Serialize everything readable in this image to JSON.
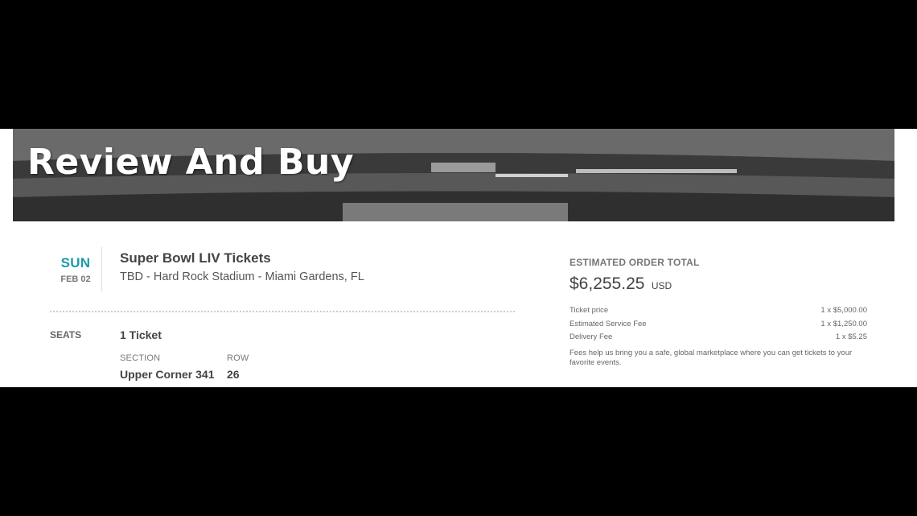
{
  "banner": {
    "title": "Review And Buy"
  },
  "event": {
    "day": "SUN",
    "date": "FEB 02",
    "title": "Super Bowl LIV Tickets",
    "venue": "TBD - Hard Rock Stadium - Miami Gardens, FL"
  },
  "seats": {
    "label": "SEATS",
    "count": "1 Ticket",
    "section_label": "SECTION",
    "section_value": "Upper Corner 341",
    "row_label": "ROW",
    "row_value": "26"
  },
  "order": {
    "label": "ESTIMATED ORDER TOTAL",
    "total": "$6,255.25",
    "currency": "USD",
    "fees": [
      {
        "name": "Ticket price",
        "value": "1 x $5,000.00"
      },
      {
        "name": "Estimated Service Fee",
        "value": "1 x $1,250.00"
      },
      {
        "name": "Delivery Fee",
        "value": "1 x $5.25"
      }
    ],
    "note": "Fees help us bring you a safe, global marketplace where you can get tickets to your favorite events."
  },
  "colors": {
    "accent": "#1b9aaa",
    "background": "#000000",
    "panel": "#ffffff"
  }
}
